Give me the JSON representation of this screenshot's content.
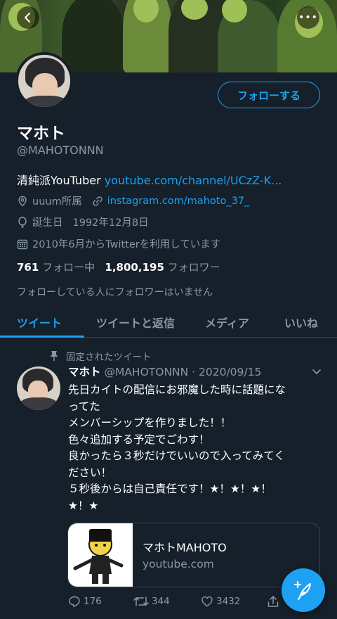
{
  "header": {
    "back_icon": "chevron-left-icon",
    "more_label": "•••"
  },
  "profile": {
    "follow_label": "フォローする",
    "name": "マホト",
    "handle": "@MAHOTONNN",
    "bio_text": "清純派YouTuber ",
    "bio_link": "youtube.com/channel/UCzZ-K...",
    "location": "uuum所属",
    "website": "instagram.com/mahoto_37_",
    "birthday_label": "誕生日",
    "birthday": "1992年12月8日",
    "joined": "2010年6月からTwitterを利用しています",
    "following_count": "761",
    "following_label": "フォロー中",
    "followers_count": "1,800,195",
    "followers_label": "フォロワー",
    "no_mutuals": "フォローしている人にフォロワーはいません"
  },
  "tabs": [
    {
      "label": "ツイート",
      "active": true
    },
    {
      "label": "ツイートと返信",
      "active": false
    },
    {
      "label": "メディア",
      "active": false
    },
    {
      "label": "いいね",
      "active": false
    }
  ],
  "tweet": {
    "pinned_label": "固定されたツイート",
    "name": "マホト",
    "handle_date": " @MAHOTONNN · 2020/09/15",
    "lines": [
      "先日カイトの配信にお邪魔した時に話題にな",
      "ってた",
      "メンバーシップを作りました！！",
      "色々追加する予定でごわす！",
      "良かったら３秒だけでいいので入ってみてく",
      "ださい！",
      "５秒後からは自己責任です！★！★！★！",
      "★！★"
    ],
    "card_title": "マホトMAHOTO",
    "card_domain": "youtube.com",
    "replies": "176",
    "retweets": "344",
    "likes": "3432"
  },
  "colors": {
    "background": "#15202b",
    "accent": "#1da1f2",
    "secondary_text": "#8899a6",
    "divider": "#38444d"
  }
}
